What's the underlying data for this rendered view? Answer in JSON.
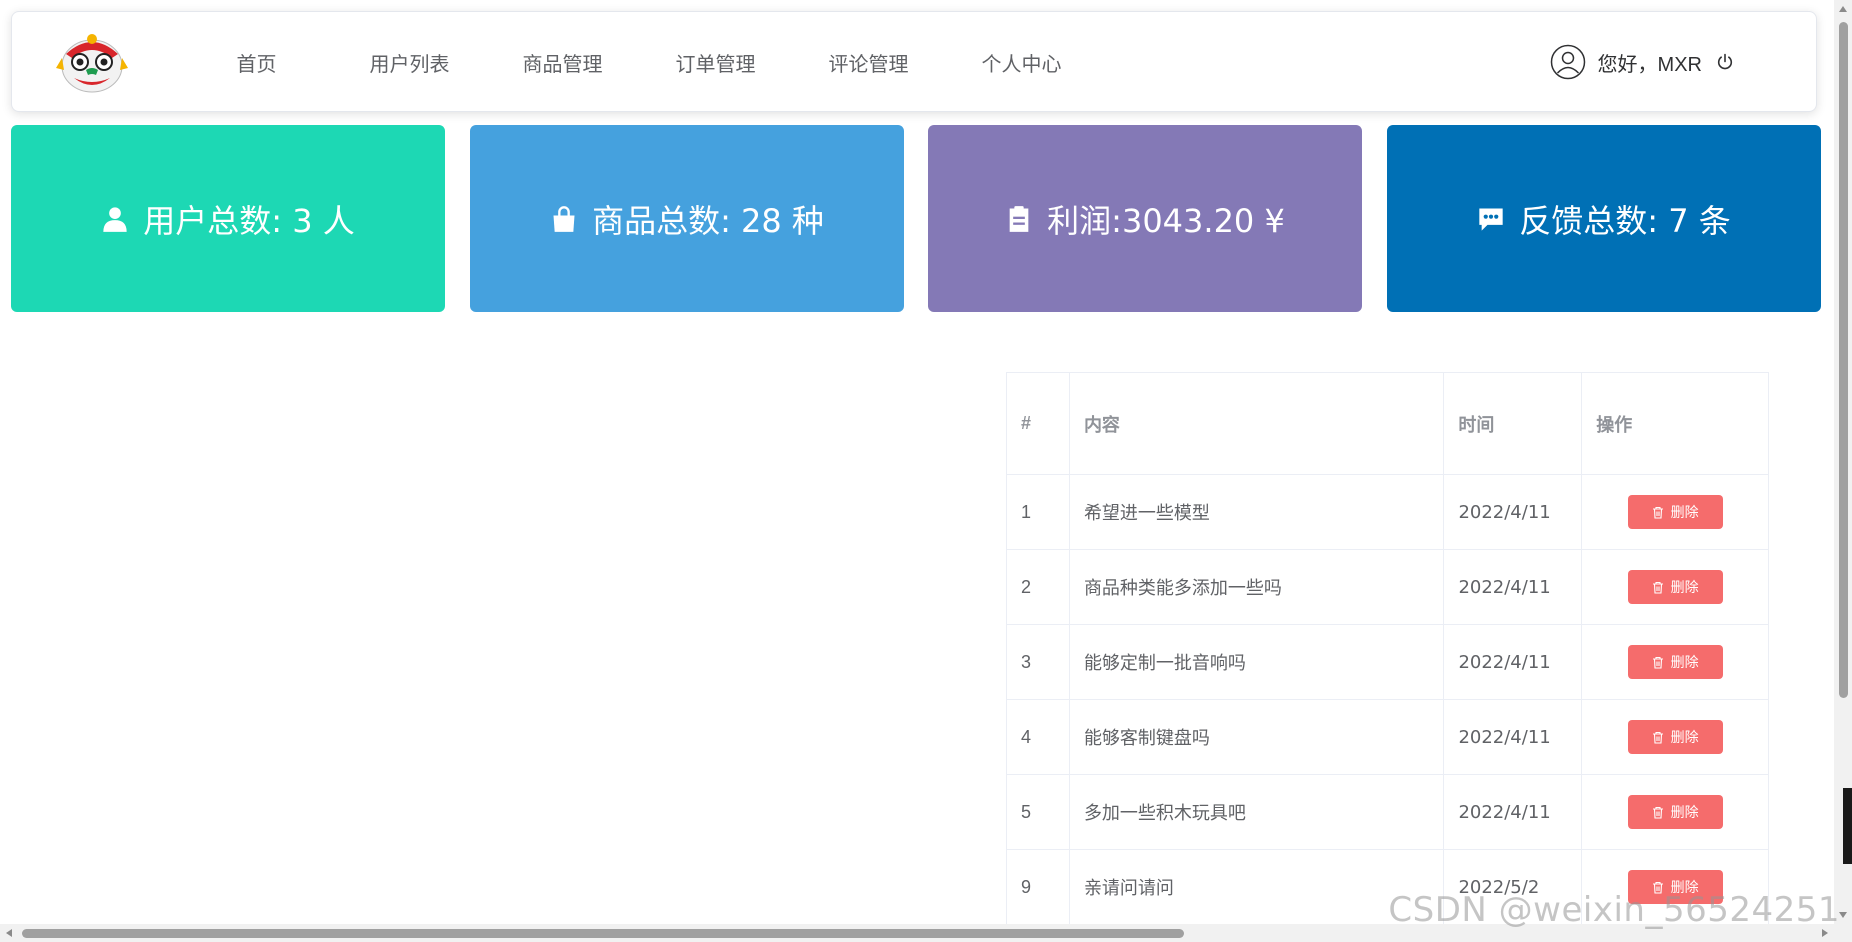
{
  "header": {
    "nav": [
      "首页",
      "用户列表",
      "商品管理",
      "订单管理",
      "评论管理",
      "个人中心"
    ],
    "greeting": "您好，MXR"
  },
  "cards": [
    {
      "icon": "user-icon",
      "text": "用户总数: 3 人",
      "color": "#1dd8b4"
    },
    {
      "icon": "shopping-bag-icon",
      "text": "商品总数: 28 种",
      "color": "#45a1de"
    },
    {
      "icon": "clipboard-icon",
      "text": "利润:3043.20 ¥",
      "color": "#8479b6"
    },
    {
      "icon": "chat-icon",
      "text": "反馈总数: 7 条",
      "color": "#0070b5"
    }
  ],
  "table": {
    "headers": [
      "#",
      "内容",
      "时间",
      "操作"
    ],
    "rows": [
      {
        "id": "1",
        "content": "希望进一些模型",
        "date": "2022/4/11"
      },
      {
        "id": "2",
        "content": "商品种类能多添加一些吗",
        "date": "2022/4/11"
      },
      {
        "id": "3",
        "content": "能够定制一批音响吗",
        "date": "2022/4/11"
      },
      {
        "id": "4",
        "content": "能够客制键盘吗",
        "date": "2022/4/11"
      },
      {
        "id": "5",
        "content": "多加一些积木玩具吧",
        "date": "2022/4/11"
      },
      {
        "id": "9",
        "content": "亲请问请问",
        "date": "2022/5/2"
      }
    ],
    "delete_label": "删除"
  },
  "watermark": "CSDN @weixin_56524251"
}
